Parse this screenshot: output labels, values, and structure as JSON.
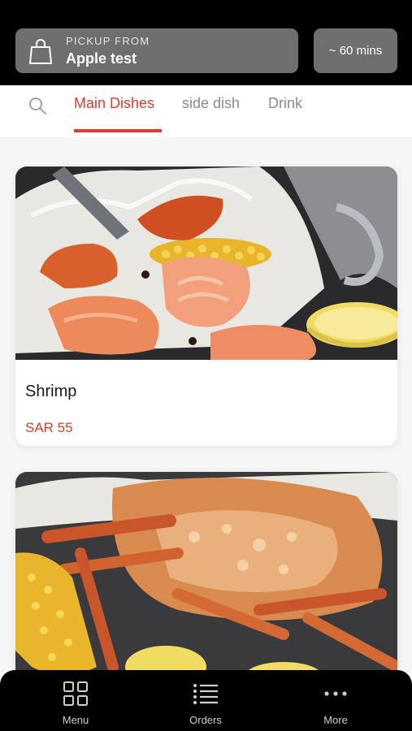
{
  "header": {
    "pickup_label": "PICKUP FROM",
    "store_name": "Apple test",
    "eta": "~ 60 mins"
  },
  "tabs": [
    {
      "label": "Main Dishes",
      "active": true
    },
    {
      "label": "side dish",
      "active": false
    },
    {
      "label": "Drink",
      "active": false
    }
  ],
  "products": [
    {
      "name": "Shrimp",
      "price": "SAR 55",
      "image": "shrimp-boil-photo"
    },
    {
      "name": "",
      "price": "",
      "image": "crab-boil-photo"
    }
  ],
  "nav": [
    {
      "label": "Menu",
      "icon": "grid-icon"
    },
    {
      "label": "Orders",
      "icon": "list-icon"
    },
    {
      "label": "More",
      "icon": "more-dots-icon"
    }
  ],
  "colors": {
    "accent": "#e23a2b",
    "header_bg": "#000000",
    "chip_bg": "#6e6e6e"
  }
}
